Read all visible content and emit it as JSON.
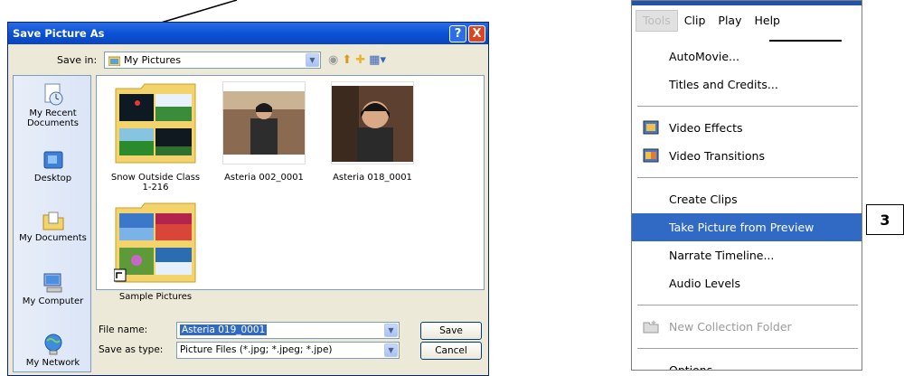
{
  "dialog": {
    "title": "Save Picture As",
    "title_buttons": {
      "help": "?",
      "close": "X"
    },
    "save_in_label": "Save in:",
    "save_in_value": "My Pictures",
    "places": [
      {
        "label_1": "My Recent",
        "label_2": "Documents",
        "icon": "recent-documents-icon"
      },
      {
        "label_1": "Desktop",
        "icon": "desktop-icon"
      },
      {
        "label_1": "My Documents",
        "icon": "my-documents-icon"
      },
      {
        "label_1": "My Computer",
        "icon": "my-computer-icon"
      },
      {
        "label_1": "My Network",
        "icon": "my-network-icon"
      }
    ],
    "files": [
      {
        "name_1": "Snow Outside Class",
        "name_2": "1-216",
        "type": "folder"
      },
      {
        "name_1": "Asteria 002_0001",
        "type": "photo"
      },
      {
        "name_1": "Asteria 018_0001",
        "type": "photo"
      },
      {
        "name_1": "Sample Pictures",
        "type": "folder-shortcut"
      }
    ],
    "file_name_label": "File name:",
    "file_name_value": "Asteria 019_0001",
    "save_type_label": "Save as type:",
    "save_type_value": "Picture Files (*.jpg; *.jpeg; *.jpe)",
    "save_button": "Save",
    "cancel_button": "Cancel"
  },
  "menu": {
    "menubar": [
      "Tools",
      "Clip",
      "Play",
      "Help"
    ],
    "items": [
      {
        "label": "AutoMovie..."
      },
      {
        "label": "Titles and Credits..."
      },
      {
        "label": "Video Effects",
        "icon": "video-effects-icon"
      },
      {
        "label": "Video Transitions",
        "icon": "video-transitions-icon"
      },
      {
        "label": "Create Clips"
      },
      {
        "label": "Take Picture from Preview"
      },
      {
        "label": "Narrate Timeline..."
      },
      {
        "label": "Audio Levels"
      },
      {
        "label": "New Collection Folder",
        "icon": "new-folder-icon"
      },
      {
        "label": "Options..."
      }
    ]
  },
  "callout_label": "3",
  "colors": {
    "title_blue": "#0a52d6",
    "highlight": "#316ac5",
    "dialog_bg": "#ece9d8"
  }
}
